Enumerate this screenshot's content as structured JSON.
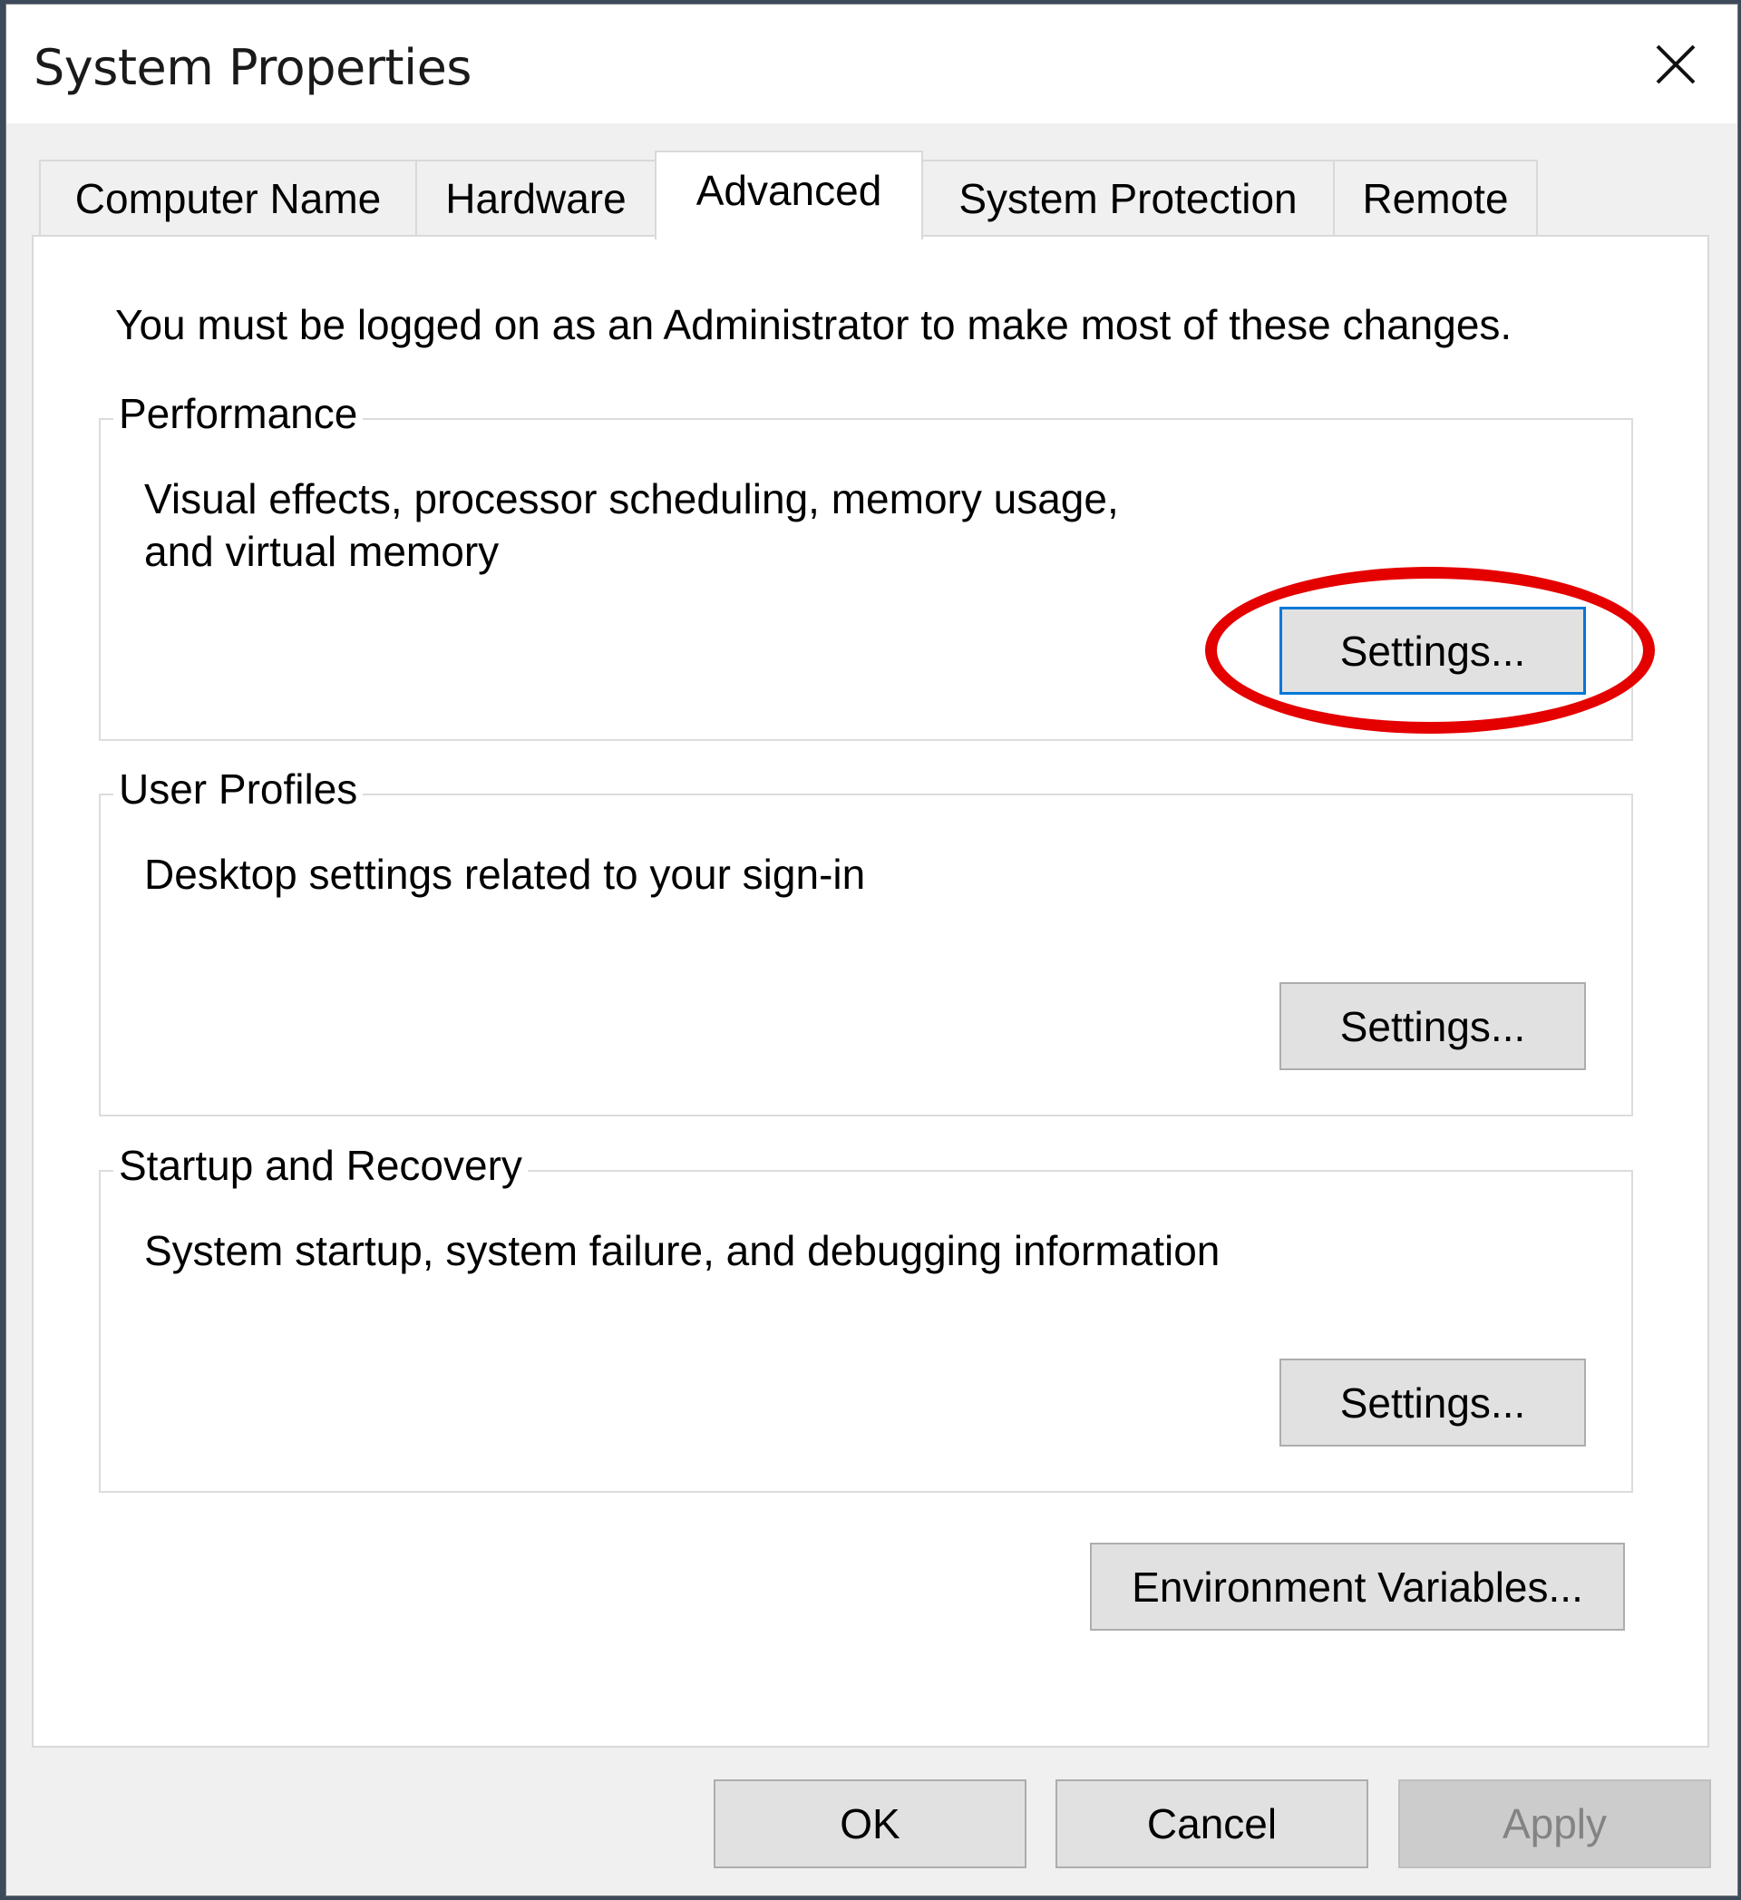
{
  "window": {
    "title": "System Properties",
    "close_icon": "close-icon"
  },
  "tabs": [
    {
      "label": "Computer Name",
      "selected": false
    },
    {
      "label": "Hardware",
      "selected": false
    },
    {
      "label": "Advanced",
      "selected": true
    },
    {
      "label": "System Protection",
      "selected": false
    },
    {
      "label": "Remote",
      "selected": false
    }
  ],
  "advanced": {
    "admin_notice": "You must be logged on as an Administrator to make most of these changes.",
    "groups": [
      {
        "legend": "Performance",
        "description": "Visual effects, processor scheduling, memory usage, and virtual memory",
        "button": "Settings...",
        "highlighted": true
      },
      {
        "legend": "User Profiles",
        "description": "Desktop settings related to your sign-in",
        "button": "Settings...",
        "highlighted": false
      },
      {
        "legend": "Startup and Recovery",
        "description": "System startup, system failure, and debugging information",
        "button": "Settings...",
        "highlighted": false
      }
    ],
    "env_button": "Environment Variables..."
  },
  "footer": {
    "ok": "OK",
    "cancel": "Cancel",
    "apply": "Apply",
    "apply_enabled": false
  },
  "annotation": {
    "color": "#e50000",
    "target": "Performance Settings... button"
  },
  "colors": {
    "focus_border": "#0078d7",
    "dialog_bg": "#f0f0f0",
    "button_bg": "#e1e1e1"
  }
}
